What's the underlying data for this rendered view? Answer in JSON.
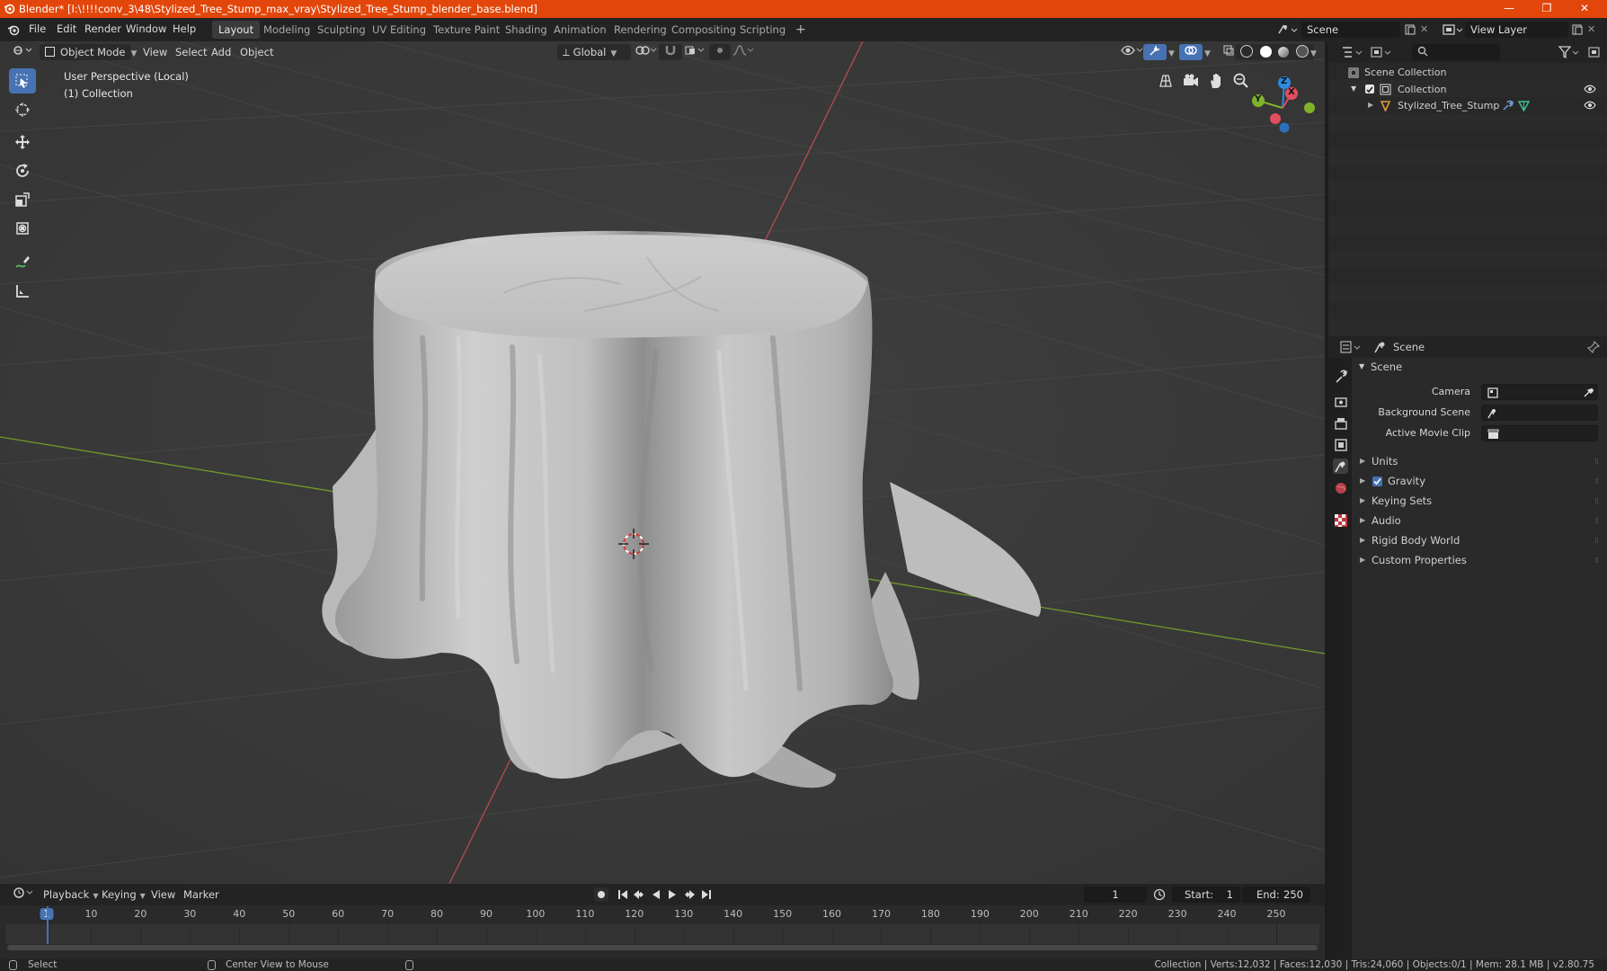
{
  "window": {
    "title": "Blender* [I:\\!!!!conv_3\\48\\Stylized_Tree_Stump_max_vray\\Stylized_Tree_Stump_blender_base.blend]",
    "controls": {
      "minimize": "—",
      "restore": "❐",
      "close": "✕"
    }
  },
  "menu": {
    "file": "File",
    "edit": "Edit",
    "render": "Render",
    "window": "Window",
    "help": "Help"
  },
  "workspaces": [
    "Layout",
    "Modeling",
    "Sculpting",
    "UV Editing",
    "Texture Paint",
    "Shading",
    "Animation",
    "Rendering",
    "Compositing",
    "Scripting"
  ],
  "active_workspace": "Layout",
  "add_workspace": "+",
  "scene_selector": {
    "value": "Scene"
  },
  "view_layer_selector": {
    "value": "View Layer"
  },
  "viewport_header": {
    "mode": "Object Mode",
    "view": "View",
    "select": "Select",
    "add": "Add",
    "object": "Object",
    "orientation": "Global"
  },
  "viewport": {
    "perspective_label": "User Perspective (Local)",
    "collection_label": "(1) Collection",
    "gizmo": {
      "x": "X",
      "y": "Y",
      "z": "Z"
    }
  },
  "tools": [
    "select-box",
    "cursor",
    "move",
    "rotate",
    "scale",
    "transform",
    "annotate",
    "measure"
  ],
  "outliner": {
    "search_placeholder": "",
    "root": "Scene Collection",
    "collection": "Collection",
    "object": "Stylized_Tree_Stump"
  },
  "properties": {
    "context": "Scene",
    "panel_title": "Scene",
    "camera_label": "Camera",
    "background_scene_label": "Background Scene",
    "active_movie_clip_label": "Active Movie Clip",
    "subpanels": [
      "Units",
      "Gravity",
      "Keying Sets",
      "Audio",
      "Rigid Body World",
      "Custom Properties"
    ],
    "gravity_checked": true
  },
  "timeline": {
    "playback": "Playback",
    "keying": "Keying",
    "view": "View",
    "marker": "Marker",
    "current_frame": "1",
    "start_label": "Start:",
    "start_value": "1",
    "end_label": "End:",
    "end_value": "250",
    "ruler_marks": [
      "1",
      "10",
      "20",
      "30",
      "40",
      "50",
      "60",
      "70",
      "80",
      "90",
      "100",
      "110",
      "120",
      "130",
      "140",
      "150",
      "160",
      "170",
      "180",
      "190",
      "200",
      "210",
      "220",
      "230",
      "240",
      "250"
    ]
  },
  "statusbar": {
    "left_action": "Select",
    "middle_action": "Center View to Mouse",
    "stats": "Collection | Verts:12,032 | Faces:12,030 | Tris:24,060 | Objects:0/1 | Mem: 28.1 MB | v2.80.75"
  },
  "colors": {
    "titlebar": "#e2460a",
    "accent": "#4772b3",
    "x_axis": "#e04f5f",
    "y_axis": "#7fb22b",
    "z_axis": "#2c8ae0"
  }
}
